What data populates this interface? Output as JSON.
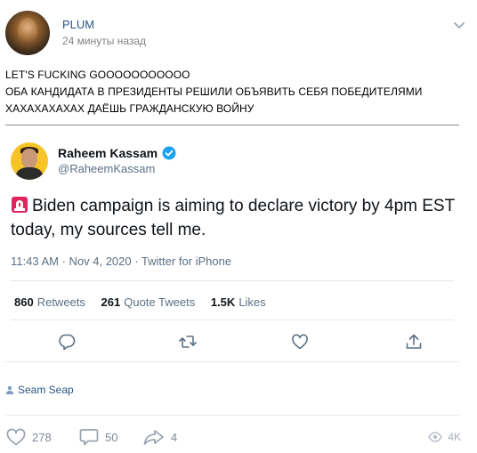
{
  "post": {
    "author": "PLUM",
    "time": "24 минуты назад",
    "text_lines": [
      "LET'S FUCKING GOOOOOOOOOOO",
      "ОБА КАНДИДАТА В ПРЕЗИДЕНТЫ РЕШИЛИ ОБЪЯВИТЬ СЕБЯ ПОБЕДИТЕЛЯМИ",
      "ХАХАХАХАХАХ ДАЁШЬ ГРАЖДАНСКУЮ ВОЙНУ"
    ]
  },
  "tweet": {
    "name": "Raheem Kassam",
    "handle": "@RaheemKassam",
    "text": "Biden campaign is aiming to declare victory by 4pm EST today, my sources tell me.",
    "meta": "11:43 AM · Nov 4, 2020 · Twitter for iPhone",
    "stats": {
      "retweets_count": "860",
      "retweets_label": "Retweets",
      "quotes_count": "261",
      "quotes_label": "Quote Tweets",
      "likes_count": "1.5K",
      "likes_label": "Likes"
    }
  },
  "source": {
    "label": "Seam Seap"
  },
  "footer": {
    "likes": "278",
    "comments": "50",
    "shares": "4",
    "views": "4K"
  },
  "colors": {
    "link": "#2a5885",
    "twitter_blue": "#1da1f2",
    "muted": "#828a99"
  }
}
